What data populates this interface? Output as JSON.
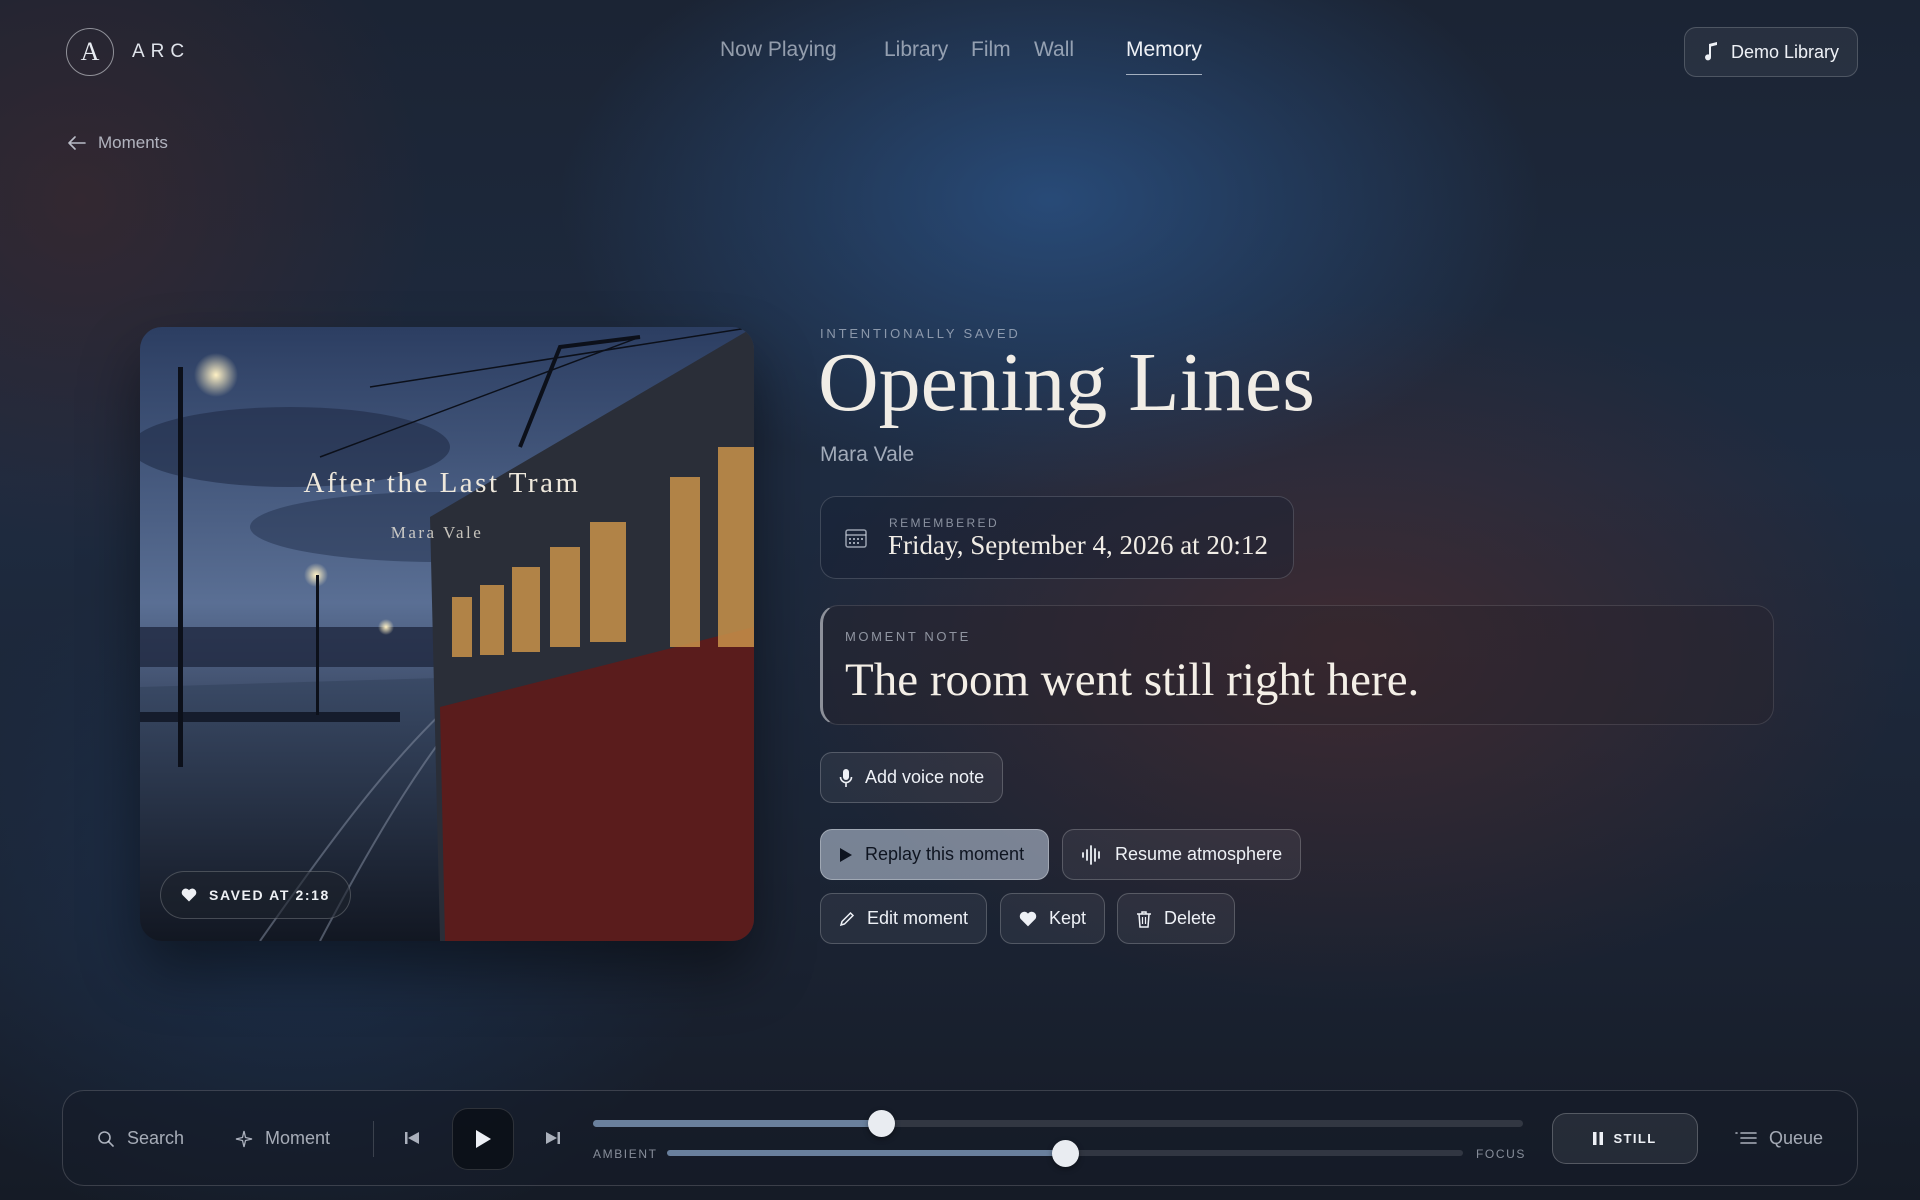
{
  "header": {
    "logo_letter": "A",
    "logo_word": "ARC",
    "nav": [
      {
        "label": "Now Playing",
        "active": false
      },
      {
        "label": "Library",
        "active": false
      },
      {
        "label": "Film",
        "active": false
      },
      {
        "label": "Wall",
        "active": false
      },
      {
        "label": "Memory",
        "active": true
      }
    ],
    "demo_library_label": "Demo Library"
  },
  "breadcrumb": {
    "back_label": "Moments"
  },
  "cover": {
    "album_title": "After the Last Tram",
    "album_artist": "Mara Vale",
    "saved_badge": "SAVED AT 2:18"
  },
  "moment": {
    "eyebrow": "INTENTIONALLY SAVED",
    "title": "Opening Lines",
    "artist": "Mara Vale",
    "remembered_label": "REMEMBERED",
    "remembered_value": "Friday, September 4, 2026 at 20:12",
    "note_label": "MOMENT NOTE",
    "note_value": "The room went still right here."
  },
  "actions": {
    "add_voice_note": "Add voice note",
    "replay": "Replay this moment",
    "resume_atmosphere": "Resume atmosphere",
    "edit": "Edit moment",
    "kept": "Kept",
    "delete": "Delete"
  },
  "player": {
    "search_label": "Search",
    "moment_label": "Moment",
    "progress": 0.31,
    "ambient_label": "AMBIENT",
    "focus_label": "FOCUS",
    "ambient_focus_level": 0.5,
    "still_label": "STILL",
    "queue_label": "Queue"
  },
  "colors": {
    "accent_primary_button": "#c4d2e4",
    "text": "#eef1f6",
    "background": "#1e2b40"
  }
}
